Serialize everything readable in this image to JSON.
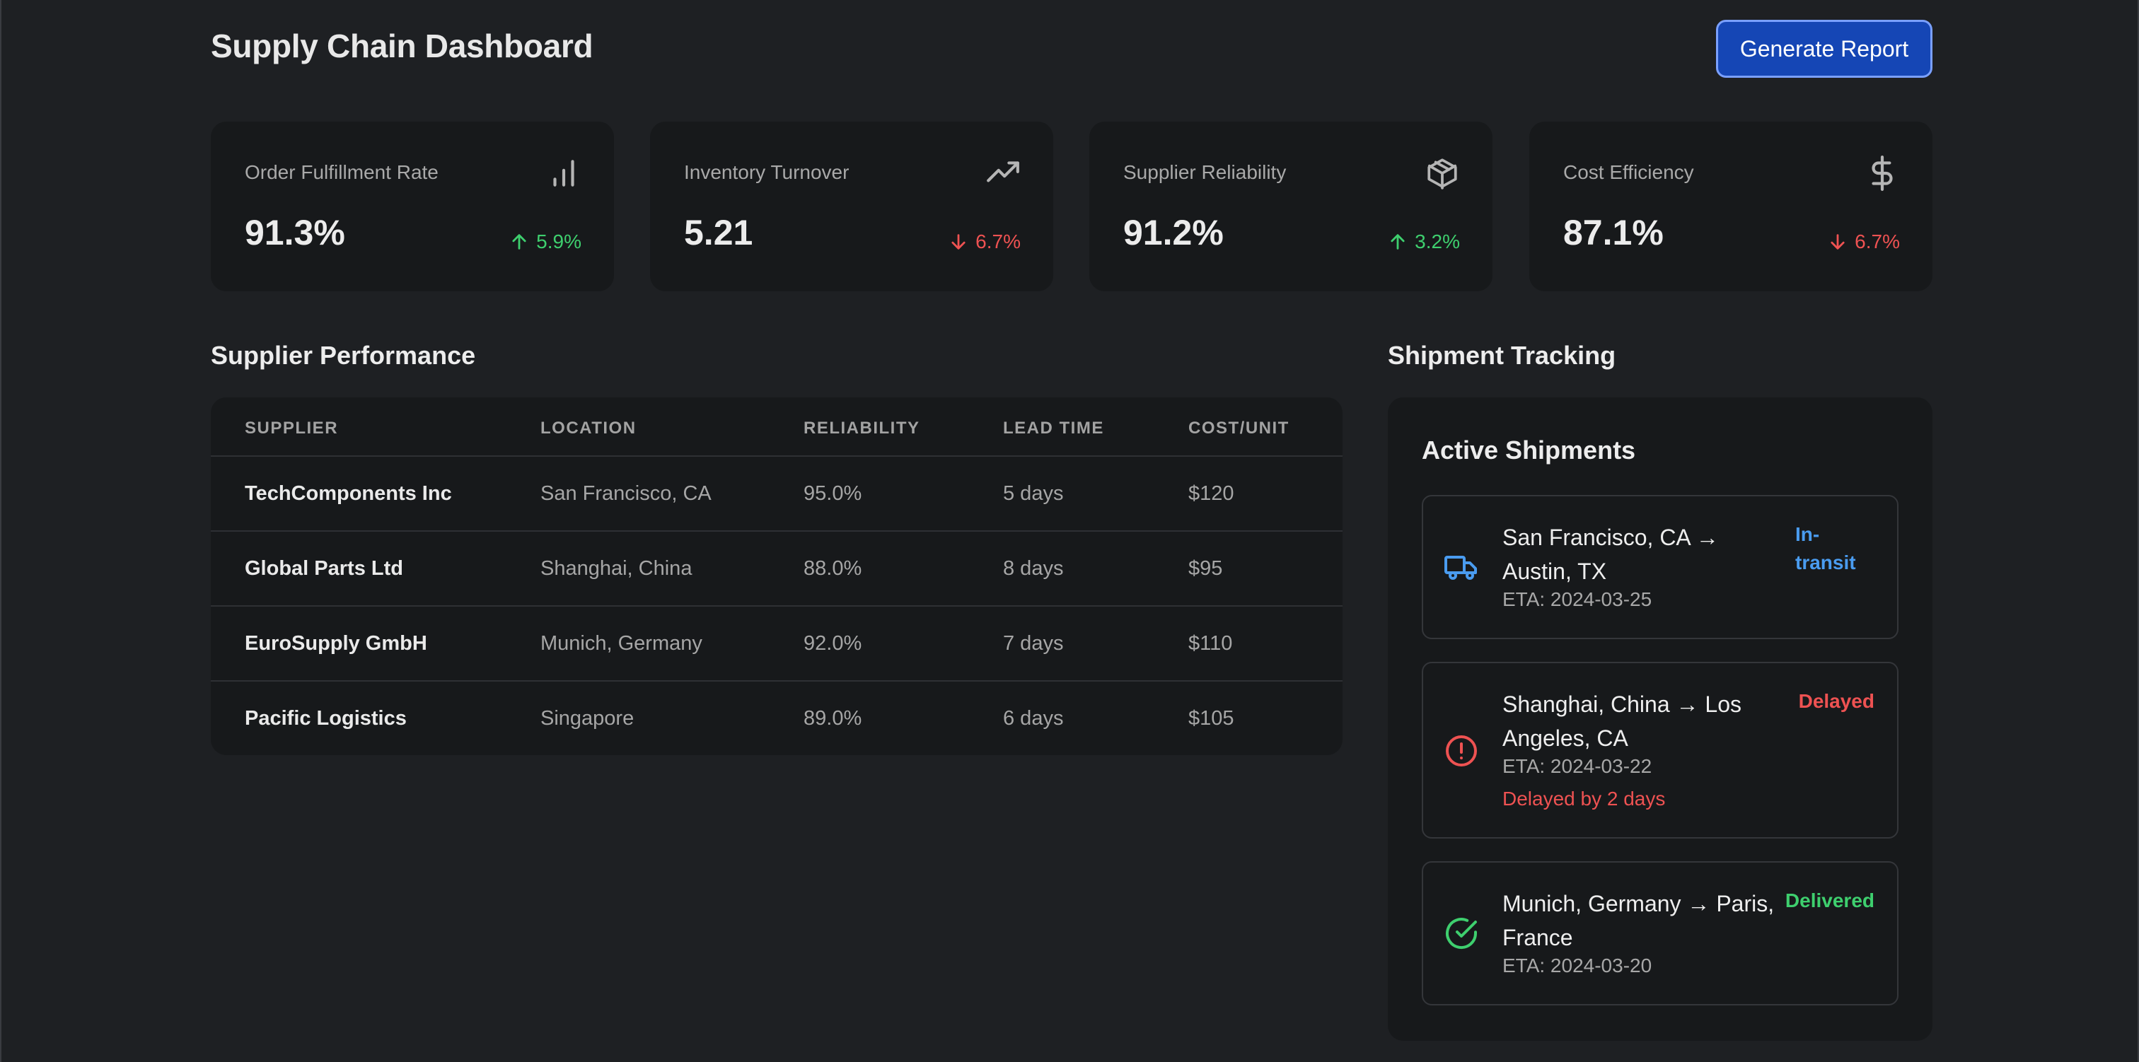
{
  "header": {
    "title": "Supply Chain Dashboard",
    "report_button": "Generate Report"
  },
  "metrics": [
    {
      "label": "Order Fulfillment Rate",
      "value": "91.3%",
      "change": "5.9%",
      "direction": "up",
      "icon": "bar-chart-icon"
    },
    {
      "label": "Inventory Turnover",
      "value": "5.21",
      "change": "6.7%",
      "direction": "down",
      "icon": "trending-up-icon"
    },
    {
      "label": "Supplier Reliability",
      "value": "91.2%",
      "change": "3.2%",
      "direction": "up",
      "icon": "package-icon"
    },
    {
      "label": "Cost Efficiency",
      "value": "87.1%",
      "change": "6.7%",
      "direction": "down",
      "icon": "dollar-icon"
    }
  ],
  "supplier_performance": {
    "title": "Supplier Performance",
    "columns": [
      "SUPPLIER",
      "LOCATION",
      "RELIABILITY",
      "LEAD TIME",
      "COST/UNIT"
    ],
    "rows": [
      [
        "TechComponents Inc",
        "San Francisco, CA",
        "95.0%",
        "5 days",
        "$120"
      ],
      [
        "Global Parts Ltd",
        "Shanghai, China",
        "88.0%",
        "8 days",
        "$95"
      ],
      [
        "EuroSupply GmbH",
        "Munich, Germany",
        "92.0%",
        "7 days",
        "$110"
      ],
      [
        "Pacific Logistics",
        "Singapore",
        "89.0%",
        "6 days",
        "$105"
      ]
    ]
  },
  "shipment_tracking": {
    "title": "Shipment Tracking",
    "heading": "Active Shipments",
    "shipments": [
      {
        "route_line1": "San Francisco, CA →",
        "route_line2": "Austin, TX",
        "eta": "ETA: 2024-03-25",
        "status_line1": "In-",
        "status_line2": "transit",
        "icon": "truck-icon"
      },
      {
        "route_line1": "Shanghai, China → Los",
        "route_line2": "Angeles, CA",
        "eta": "ETA: 2024-03-22",
        "note": "Delayed by 2 days",
        "status_line1": "Delayed",
        "icon": "alert-circle-icon"
      },
      {
        "route_line1": "Munich, Germany → Paris,",
        "route_line2": "France",
        "eta": "ETA: 2024-03-20",
        "status_line1": "Delivered",
        "icon": "check-circle-icon"
      }
    ]
  },
  "colors": {
    "background": "#1e2023",
    "card": "#17191b",
    "accent": "#1546b5",
    "positive": "#3ecf6e",
    "negative": "#ee5252",
    "in_transit": "#4a9cf0"
  }
}
